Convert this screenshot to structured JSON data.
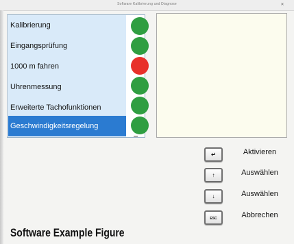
{
  "window": {
    "title": "Software Kalibrierung und Diagnose",
    "close_glyph": "✕"
  },
  "test_list": {
    "items": [
      {
        "label": "Kalibrierung",
        "status": "ok",
        "status_color": "#2f9e41",
        "selected": false
      },
      {
        "label": "Eingangsprüfung",
        "status": "ok",
        "status_color": "#2f9e41",
        "selected": false
      },
      {
        "label": "1000 m fahren",
        "status": "error",
        "status_color": "#e8302a",
        "selected": false
      },
      {
        "label": "Uhrenmessung",
        "status": "ok",
        "status_color": "#2f9e41",
        "selected": false
      },
      {
        "label": "Erweiterte Tachofunktionen",
        "status": "ok",
        "status_color": "#2f9e41",
        "selected": false
      },
      {
        "label": "Geschwindigkeitsregelung",
        "status": "ok",
        "status_color": "#2f9e41",
        "selected": true
      }
    ]
  },
  "actions": [
    {
      "key": "↵",
      "key_icon": "enter-key-icon",
      "label": "Aktivieren"
    },
    {
      "key": "↑",
      "key_icon": "arrow-up-key-icon",
      "label": "Auswählen"
    },
    {
      "key": "↓",
      "key_icon": "arrow-down-key-icon",
      "label": "Auswählen"
    },
    {
      "key": "ESC",
      "key_icon": "escape-key-icon",
      "label": "Abbrechen"
    }
  ],
  "caption": {
    "text": "Software Example Figure"
  },
  "colors": {
    "list_item_bg": "#d9eaf9",
    "selected_bg": "#2b7bd1",
    "status_ok": "#2f9e41",
    "status_error": "#e8302a",
    "detail_panel_bg": "#fcfcee"
  }
}
